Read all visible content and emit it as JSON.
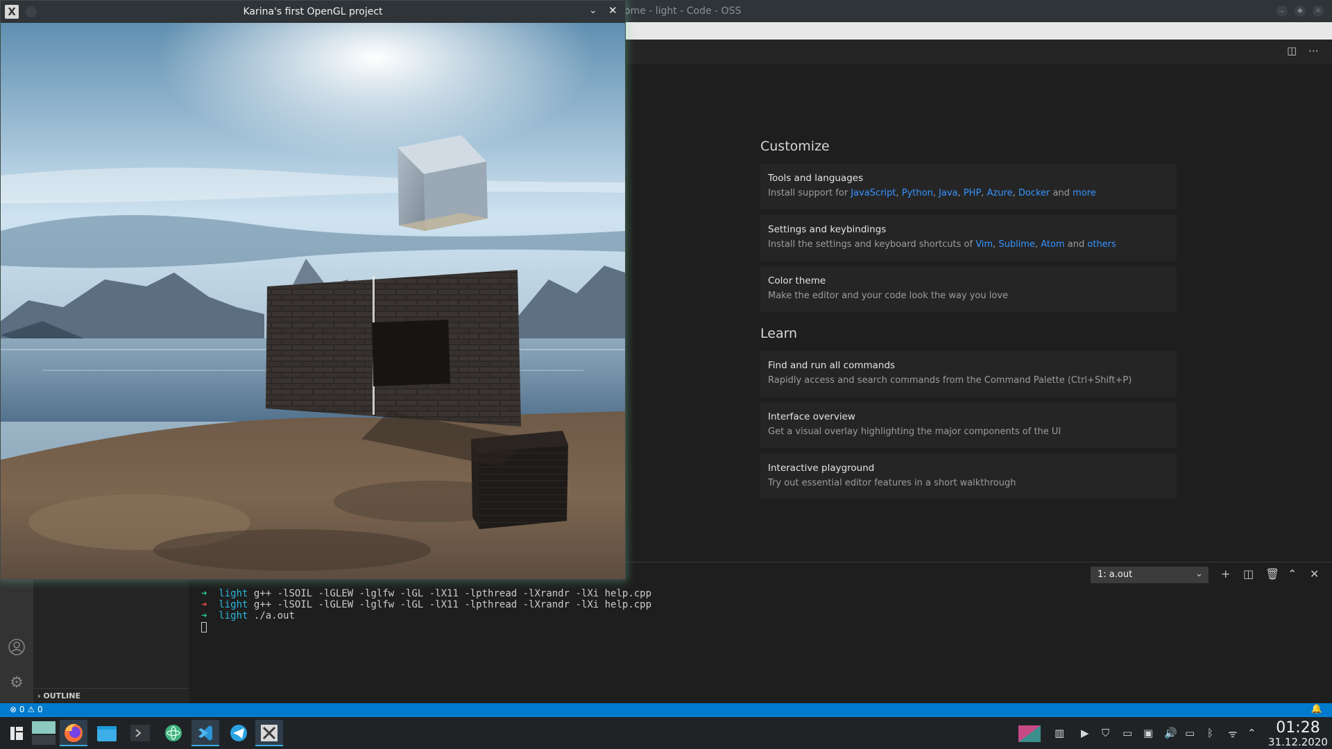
{
  "vscode": {
    "window_title": "ome - light - Code - OSS",
    "welcome": {
      "customize": {
        "heading": "Customize",
        "cards": [
          {
            "title": "Tools and languages",
            "desc_prefix": "Install support for ",
            "links": [
              "JavaScript",
              "Python",
              "Java",
              "PHP",
              "Azure",
              "Docker"
            ],
            "and_word": "and",
            "more_link": "more"
          },
          {
            "title": "Settings and keybindings",
            "desc_prefix": "Install the settings and keyboard shortcuts of ",
            "links": [
              "Vim",
              "Sublime",
              "Atom"
            ],
            "and_word": "and",
            "more_link": "others"
          },
          {
            "title": "Color theme",
            "desc": "Make the editor and your code look the way you love"
          }
        ]
      },
      "learn": {
        "heading": "Learn",
        "cards": [
          {
            "title": "Find and run all commands",
            "desc": "Rapidly access and search commands from the Command Palette (Ctrl+Shift+P)"
          },
          {
            "title": "Interface overview",
            "desc": "Get a visual overlay highlighting the major components of the UI"
          },
          {
            "title": "Interactive playground",
            "desc": "Try out essential editor features in a short walkthrough"
          }
        ]
      }
    },
    "terminal": {
      "selected": "1: a.out",
      "lines": [
        {
          "status": "ok",
          "dir": "light",
          "cmd": "g++ -lSOIL -lGLEW -lglfw -lGL -lX11 -lpthread -lXrandr -lXi help.cpp"
        },
        {
          "status": "err",
          "dir": "light",
          "cmd": "g++ -lSOIL -lGLEW -lglfw -lGL -lX11 -lpthread -lXrandr -lXi help.cpp"
        },
        {
          "status": "ok",
          "dir": "light",
          "cmd": "./a.out"
        }
      ],
      "arrow": "➜"
    },
    "sidebar": {
      "outline_label": "OUTLINE"
    },
    "statusbar": {
      "errors": "0",
      "warnings": "0"
    }
  },
  "opengl_window": {
    "title": "Karina's first OpenGL project"
  },
  "taskbar": {
    "clock_time": "01:28",
    "clock_date": "31.12.2020",
    "items": [
      "application-launcher",
      "desktop-pager",
      "firefox",
      "dolphin-files",
      "konsole",
      "atom",
      "vscode",
      "telegram",
      "opengl-app"
    ],
    "tray": [
      "clipboard",
      "media-player",
      "vpn-shield",
      "terminal",
      "device-notifier",
      "volume",
      "battery",
      "bluetooth",
      "network",
      "expand-tray"
    ]
  },
  "colors": {
    "accent": "#007acc",
    "link": "#3794ff",
    "kde_highlight": "#3daee9"
  }
}
